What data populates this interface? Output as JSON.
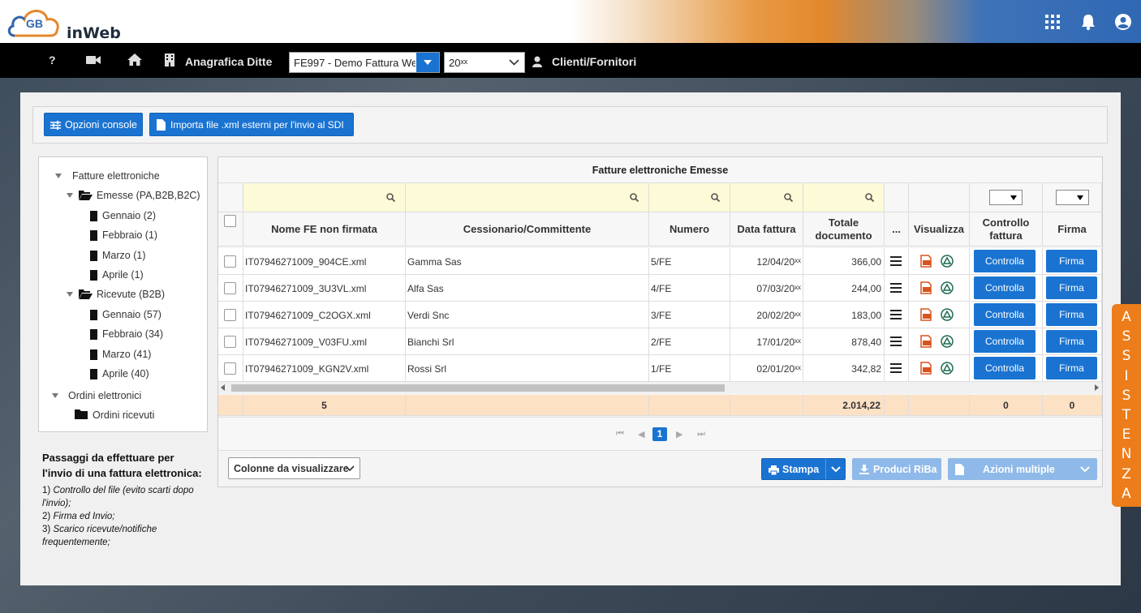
{
  "header": {
    "brand": "inWeb",
    "logo_letters": "GB",
    "icons": [
      "apps-grid-icon",
      "bell-icon",
      "user-circle-icon"
    ]
  },
  "nav": {
    "help": "?",
    "company_label": "Anagrafica Ditte",
    "company_value": "FE997 - Demo Fattura We",
    "year_value": "20ˣˣ",
    "clients_label": "Clienti/Fornitori"
  },
  "toolbar": {
    "console_options": "Opzioni console",
    "import_xml": "Importa file .xml esterni per l'invio al SDI"
  },
  "tree": {
    "root": "Fatture elettroniche",
    "sent": {
      "label": "Emesse (PA,B2B,B2C)",
      "months": [
        "Gennaio (2)",
        "Febbraio (1)",
        "Marzo (1)",
        "Aprile (1)"
      ]
    },
    "received": {
      "label": "Ricevute (B2B)",
      "months": [
        "Gennaio (57)",
        "Febbraio (34)",
        "Marzo (41)",
        "Aprile (40)"
      ]
    },
    "orders_root": "Ordini elettronici",
    "orders_received": "Ordini ricevuti"
  },
  "steps": {
    "title": "Passaggi da effettuare per l'invio di una fattura elettronica:",
    "items": [
      {
        "num": "1)",
        "text": "Controllo del file (evito scarti dopo l'invio);"
      },
      {
        "num": "2)",
        "text": "Firma ed Invio;"
      },
      {
        "num": "3)",
        "text": "Scarico ricevute/notifiche frequentemente;"
      }
    ]
  },
  "grid": {
    "title": "Fatture elettroniche Emesse",
    "columns": {
      "name": "Nome FE non firmata",
      "customer": "Cessionario/Committente",
      "number": "Numero",
      "date": "Data fattura",
      "total_l1": "Totale",
      "total_l2": "documento",
      "more": "...",
      "view": "Visualizza",
      "check_l1": "Controllo",
      "check_l2": "fattura",
      "sign": "Firma"
    },
    "rows": [
      {
        "name": "IT07946271009_904CE.xml",
        "customer": "Gamma Sas",
        "number": "5/FE",
        "date": "12/04/20ˣˣ",
        "total": "366,00"
      },
      {
        "name": "IT07946271009_3U3VL.xml",
        "customer": "Alfa Sas",
        "number": "4/FE",
        "date": "07/03/20ˣˣ",
        "total": "244,00"
      },
      {
        "name": "IT07946271009_C2OGX.xml",
        "customer": "Verdi Snc",
        "number": "3/FE",
        "date": "20/02/20ˣˣ",
        "total": "183,00"
      },
      {
        "name": "IT07946271009_V03FU.xml",
        "customer": "Bianchi Srl",
        "number": "2/FE",
        "date": "17/01/20ˣˣ",
        "total": "878,40"
      },
      {
        "name": "IT07946271009_KGN2V.xml",
        "customer": "Rossi Srl",
        "number": "1/FE",
        "date": "02/01/20ˣˣ",
        "total": "342,82"
      }
    ],
    "check_button": "Controlla",
    "sign_button": "Firma",
    "totals": {
      "count": "5",
      "amount": "2.014,22",
      "checked": "0",
      "signed": "0"
    },
    "page": "1"
  },
  "bottom": {
    "columns_select": "Colonne da visualizzare",
    "print": "Stampa",
    "riba": "Produci RiBa",
    "multi": "Azioni multiple"
  },
  "assist_letters": [
    "A",
    "S",
    "S",
    "I",
    "S",
    "T",
    "E",
    "N",
    "Z",
    "A"
  ],
  "colors": {
    "primary": "#1a73d1",
    "accent": "#ec7d1a",
    "filter_row": "#fcfad7",
    "total_row": "#fde1c5"
  }
}
